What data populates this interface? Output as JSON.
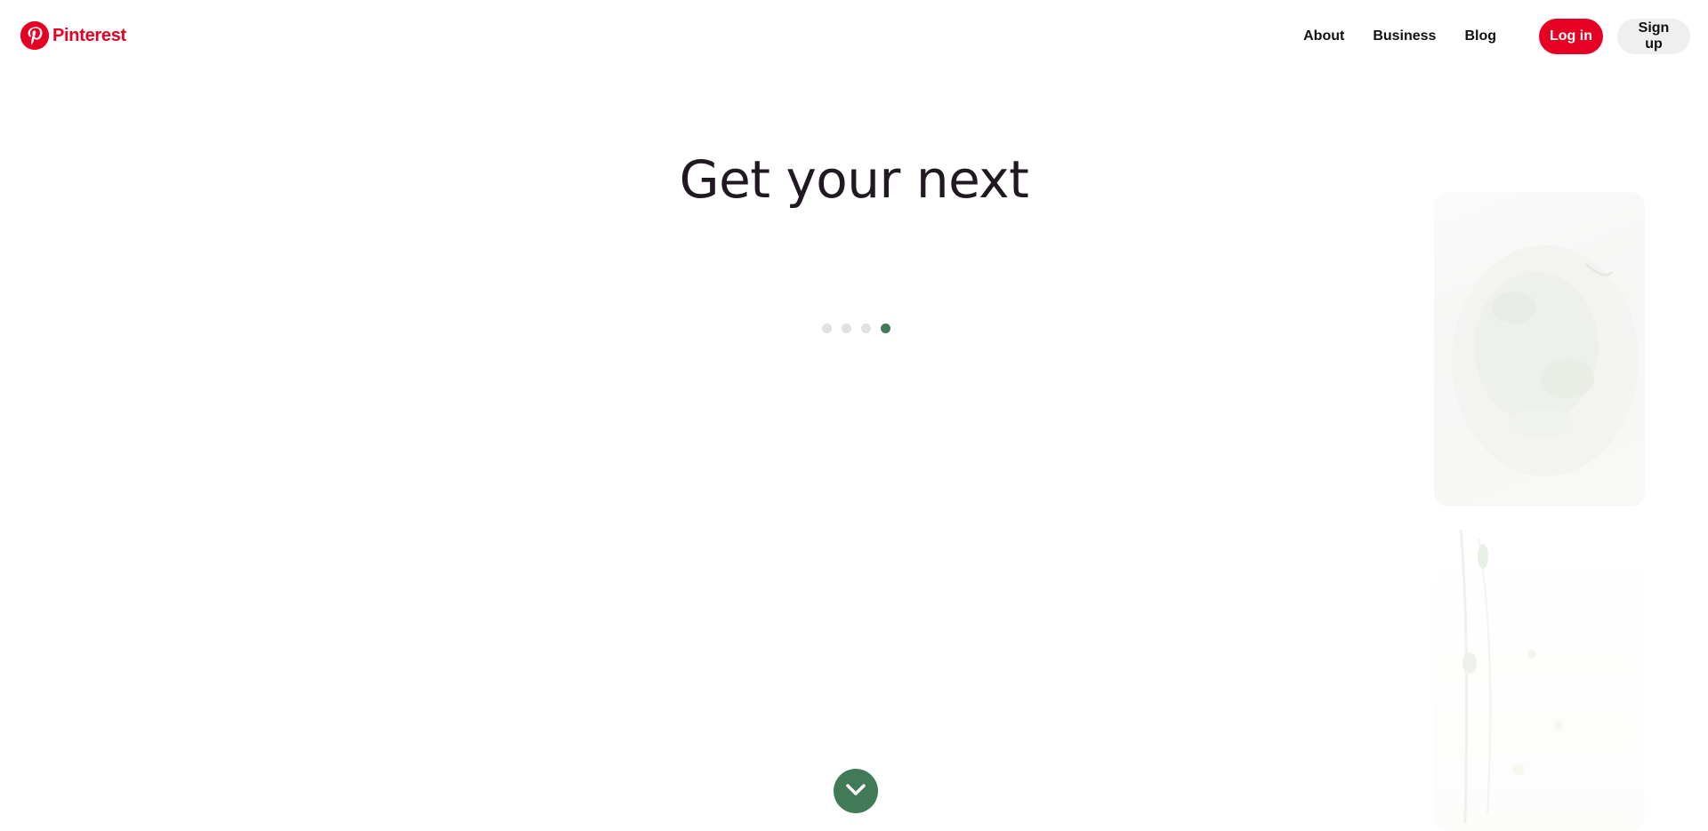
{
  "brand": {
    "name": "Pinterest",
    "color": "#e60023",
    "icon": "pinterest-logo-icon"
  },
  "nav": {
    "about": "About",
    "business": "Business",
    "blog": "Blog",
    "login": "Log in",
    "signup": "Sign up"
  },
  "hero": {
    "title": "Get your next",
    "accent_color": "#407a57"
  },
  "carousel": {
    "dots": 4,
    "active_index": 3
  },
  "scroll_button": {
    "icon": "chevron-down-icon"
  }
}
